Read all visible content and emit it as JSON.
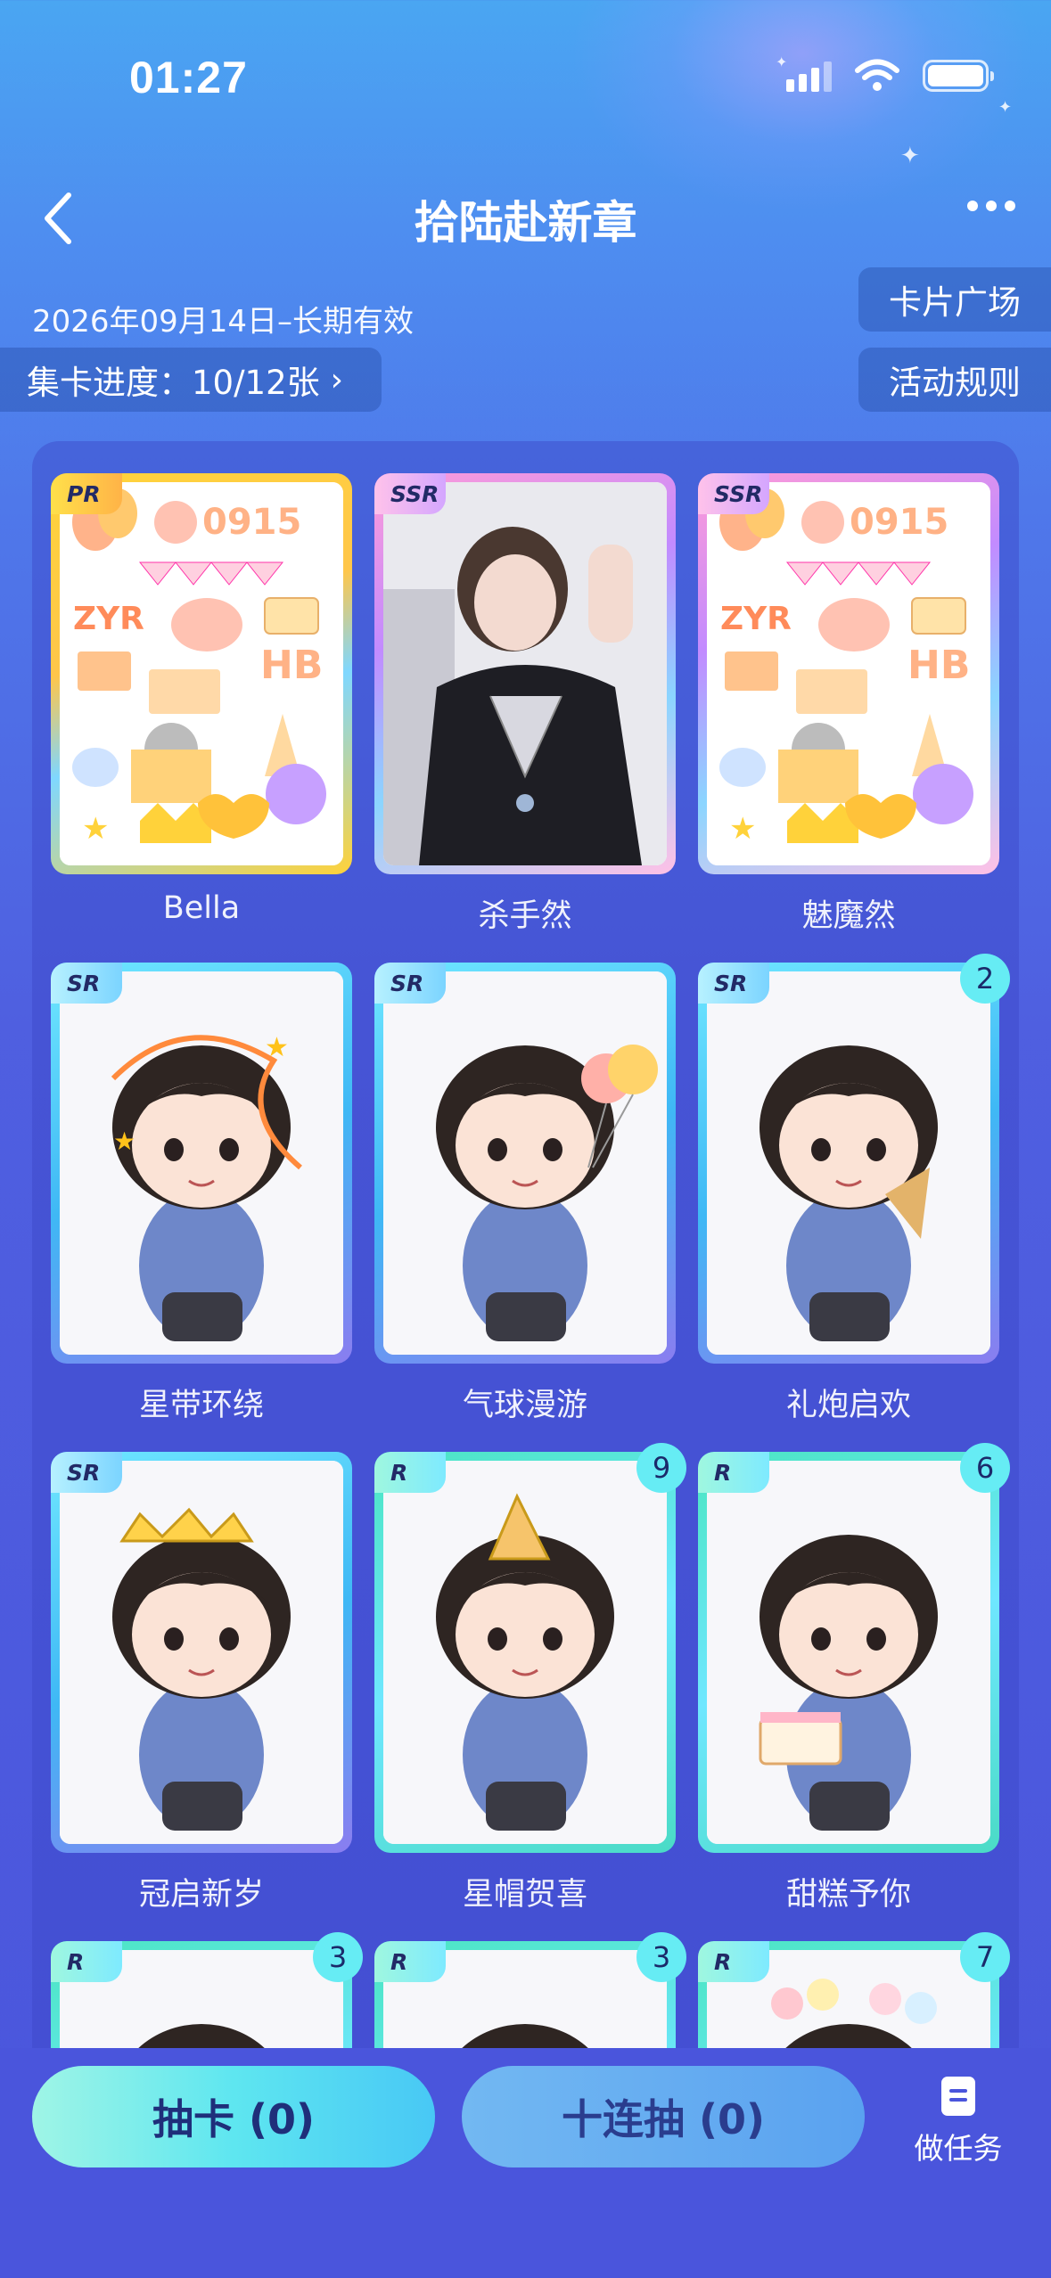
{
  "status_bar": {
    "time": "01:27"
  },
  "header": {
    "title": "拾陆赴新章"
  },
  "info": {
    "date_range": "2026年09月14日–长期有效",
    "progress_label": "集卡进度：10/12张"
  },
  "side_buttons": {
    "card_plaza": "卡片广场",
    "rules": "活动规则"
  },
  "cards": [
    {
      "name": "Bella",
      "rarity": "PR",
      "count": "",
      "art": "stickers"
    },
    {
      "name": "杀手然",
      "rarity": "SSR",
      "count": "",
      "art": "portrait"
    },
    {
      "name": "魅魔然",
      "rarity": "SSR",
      "count": "",
      "art": "stickers"
    },
    {
      "name": "星带环绕",
      "rarity": "SR",
      "count": "",
      "art": "chibi-ribbons"
    },
    {
      "name": "气球漫游",
      "rarity": "SR",
      "count": "",
      "art": "chibi-balloons"
    },
    {
      "name": "礼炮启欢",
      "rarity": "SR",
      "count": "2",
      "art": "chibi-popper"
    },
    {
      "name": "冠启新岁",
      "rarity": "SR",
      "count": "",
      "art": "chibi-crown"
    },
    {
      "name": "星帽贺喜",
      "rarity": "R",
      "count": "9",
      "art": "chibi-hat"
    },
    {
      "name": "甜糕予你",
      "rarity": "R",
      "count": "6",
      "art": "chibi-cake"
    },
    {
      "name": "",
      "rarity": "R",
      "count": "3",
      "art": "chibi"
    },
    {
      "name": "",
      "rarity": "R",
      "count": "3",
      "art": "chibi"
    },
    {
      "name": "",
      "rarity": "R",
      "count": "7",
      "art": "chibi-flowers"
    }
  ],
  "bottom": {
    "draw_label": "抽卡 (0)",
    "ten_draw_label": "十连抽 (0)",
    "task_label": "做任务"
  },
  "colors": {
    "accent": "#5ee6f0",
    "background": "#4f5fe0"
  }
}
